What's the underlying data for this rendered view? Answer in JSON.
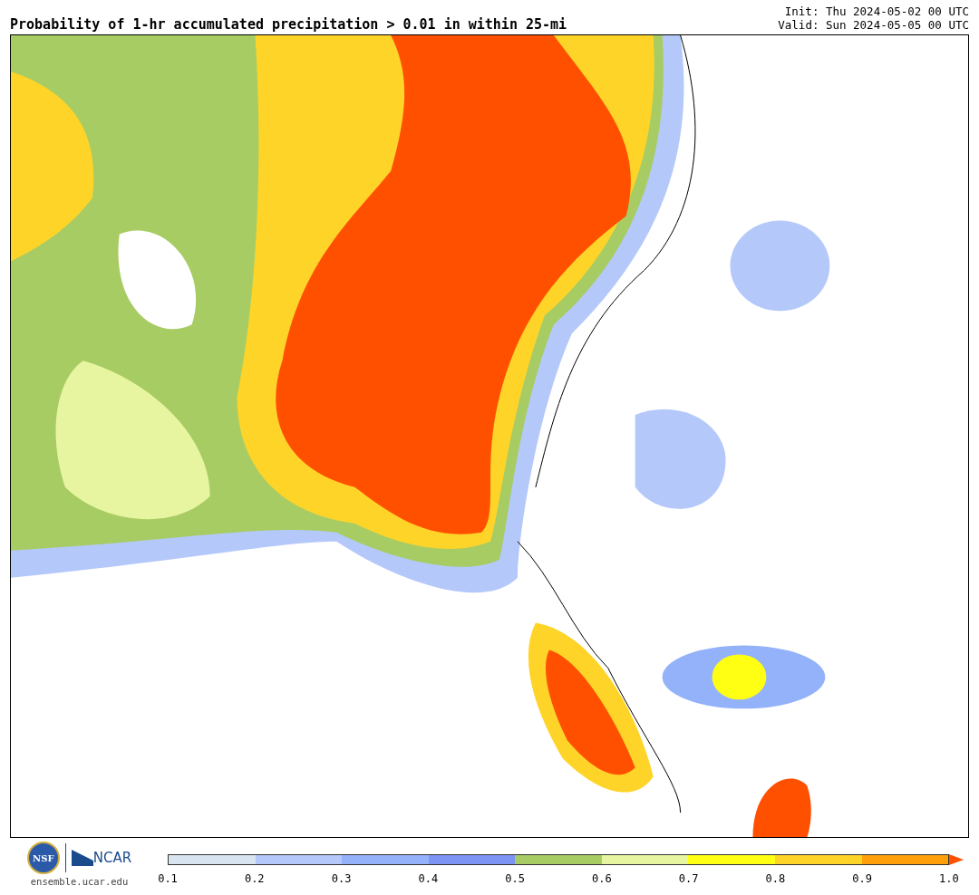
{
  "title": "Probability of 1-hr accumulated precipitation > 0.01 in within 25-mi",
  "init": "Init: Thu 2024-05-02 00 UTC",
  "valid": "Valid: Sun 2024-05-05 00 UTC",
  "logos": {
    "nsf": "NSF",
    "ncar": "NCAR",
    "site": "ensemble.ucar.edu"
  },
  "legend": {
    "bins": [
      {
        "color": "#d8e4ef"
      },
      {
        "color": "#b4c8fa"
      },
      {
        "color": "#94b2fa"
      },
      {
        "color": "#7d94f5"
      },
      {
        "color": "#a8cc64"
      },
      {
        "color": "#e8f5a0"
      },
      {
        "color": "#ffff14"
      },
      {
        "color": "#ffd428"
      },
      {
        "color": "#ffa00a"
      }
    ],
    "over": {
      "color": "#ff5000"
    },
    "ticks": [
      "0.1",
      "0.2",
      "0.3",
      "0.4",
      "0.5",
      "0.6",
      "0.7",
      "0.8",
      "0.9",
      "1.0"
    ]
  }
}
